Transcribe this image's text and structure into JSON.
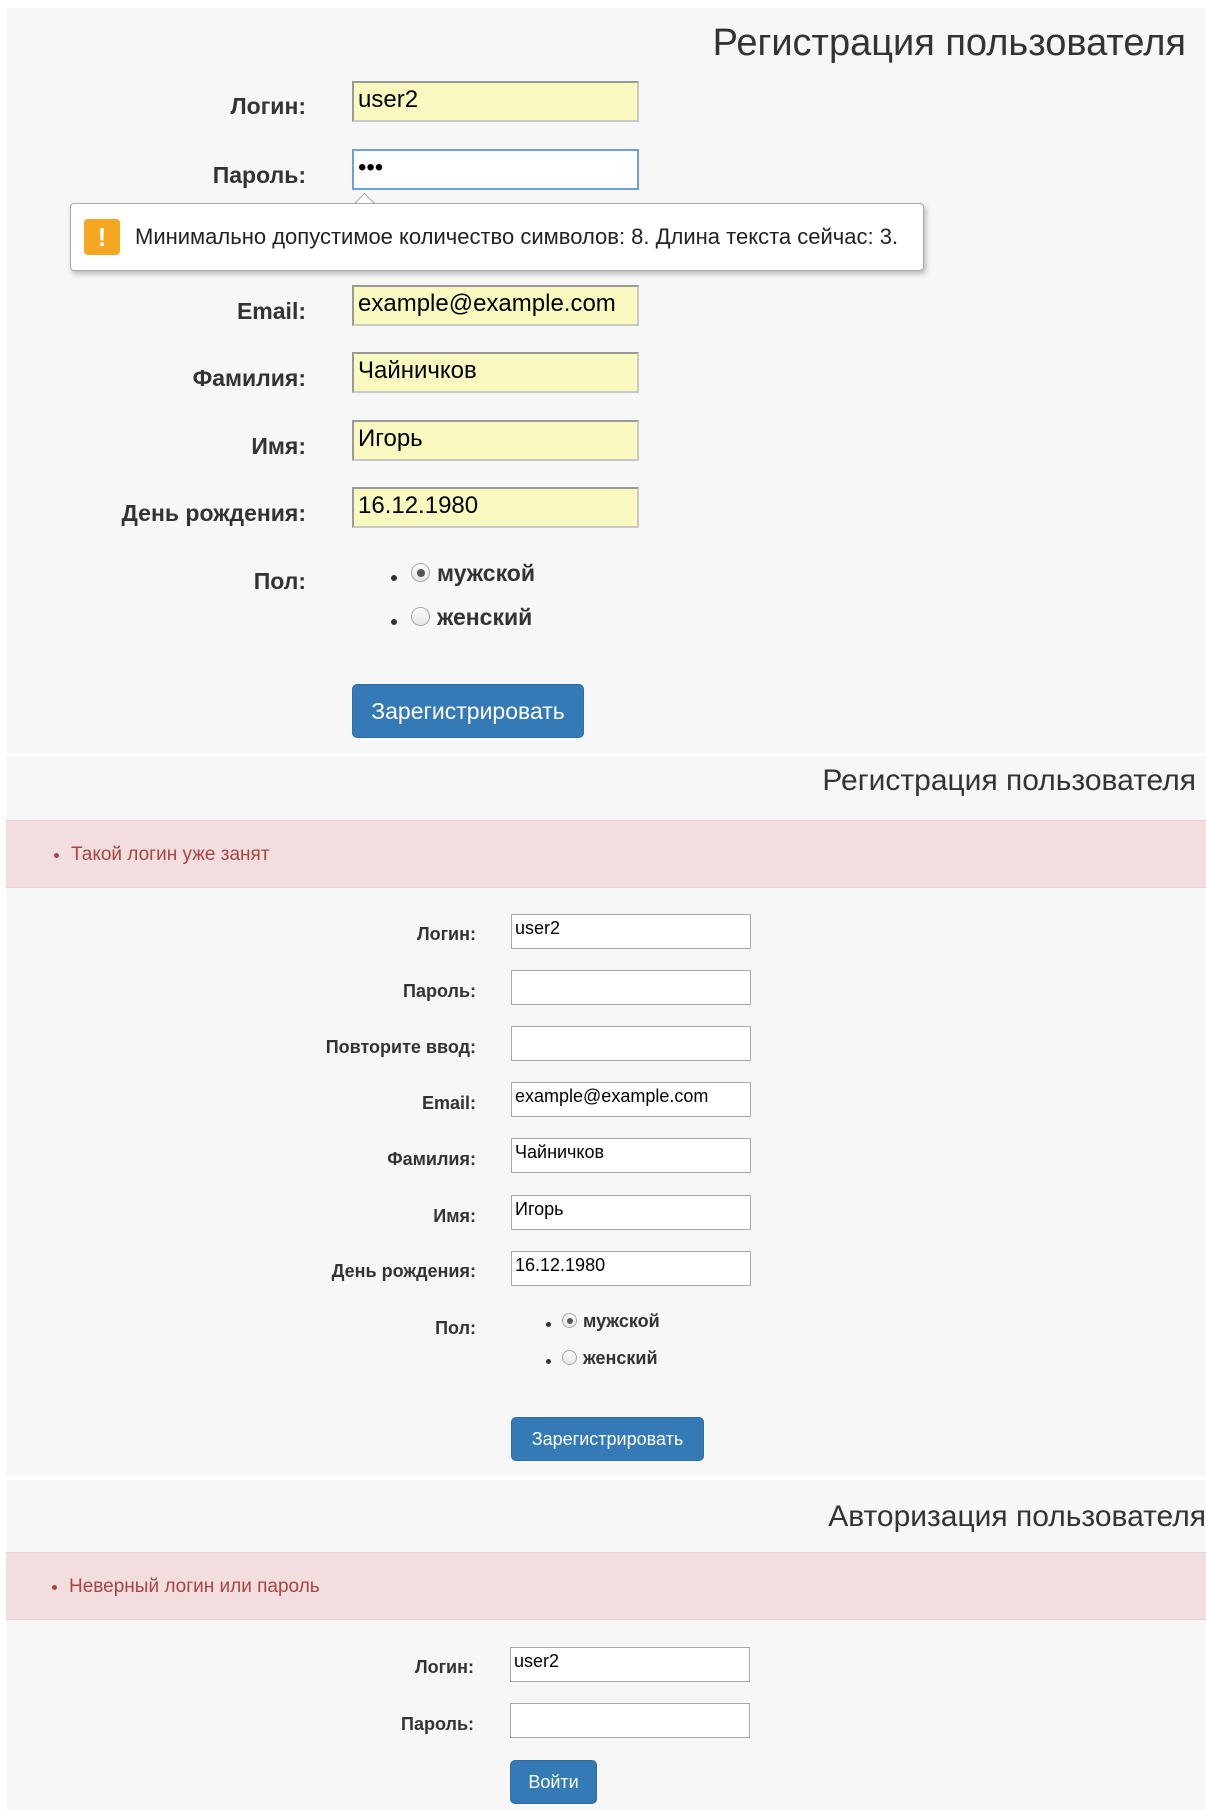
{
  "reg_form_1": {
    "title": "Регистрация пользователя",
    "labels": {
      "login": "Логин:",
      "password": "Пароль:",
      "email": "Email:",
      "surname": "Фамилия:",
      "name": "Имя:",
      "birthday": "День рождения:",
      "gender": "Пол:"
    },
    "values": {
      "login": "user2",
      "password": "•••",
      "email": "example@example.com",
      "surname": "Чайничков",
      "name": "Игорь",
      "birthday": "16.12.1980"
    },
    "gender_options": [
      "мужской",
      "женский"
    ],
    "gender_selected": "мужской",
    "submit_label": "Зарегистрировать",
    "tooltip": {
      "icon": "warning-icon",
      "text": "Минимально допустимое количество символов: 8. Длина текста сейчас: 3."
    }
  },
  "reg_form_2": {
    "title": "Регистрация пользователя",
    "error": "Такой логин уже занят",
    "labels": {
      "login": "Логин:",
      "password": "Пароль:",
      "repeat": "Повторите ввод:",
      "email": "Email:",
      "surname": "Фамилия:",
      "name": "Имя:",
      "birthday": "День рождения:",
      "gender": "Пол:"
    },
    "values": {
      "login": "user2",
      "password": "",
      "repeat": "",
      "email": "example@example.com",
      "surname": "Чайничков",
      "name": "Игорь",
      "birthday": "16.12.1980"
    },
    "gender_options": [
      "мужской",
      "женский"
    ],
    "gender_selected": "мужской",
    "submit_label": "Зарегистрировать"
  },
  "auth_form": {
    "title": "Авторизация пользователя",
    "error": "Неверный логин или пароль",
    "labels": {
      "login": "Логин:",
      "password": "Пароль:"
    },
    "values": {
      "login": "user2",
      "password": ""
    },
    "submit_label": "Войти"
  },
  "colors": {
    "panel_bg": "#f7f7f7",
    "autofill_bg": "#fafac0",
    "focus_border": "#6c9fe2",
    "alert_bg": "#f2dede",
    "alert_text": "#a94442",
    "button_bg": "#337ab7",
    "warning_icon": "#f5a623"
  }
}
